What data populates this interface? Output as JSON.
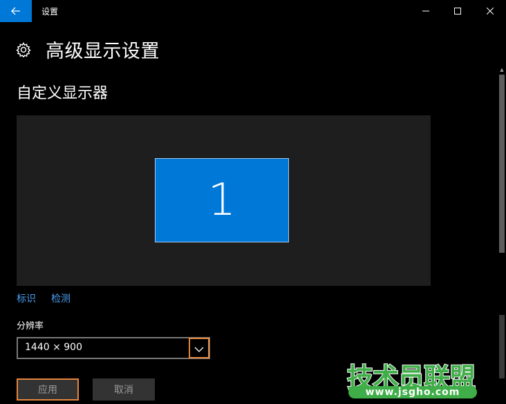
{
  "titlebar": {
    "app_title": "设置",
    "back_icon": "back-arrow-icon",
    "accent_color": "#0078d7"
  },
  "header": {
    "page_title": "高级显示设置",
    "icon": "gear-icon"
  },
  "main": {
    "section_title": "自定义显示器",
    "monitor_number": "1",
    "links": {
      "identify": "标识",
      "detect": "检测"
    },
    "resolution": {
      "label": "分辨率",
      "value": "1440 × 900"
    },
    "buttons": {
      "apply": "应用",
      "cancel": "取消"
    }
  },
  "watermark": {
    "brand": "技术员联盟",
    "url": "www.jsgho.com",
    "color": "#3fae48"
  },
  "colors": {
    "highlight": "#e8863a",
    "link": "#4c9ff5"
  }
}
